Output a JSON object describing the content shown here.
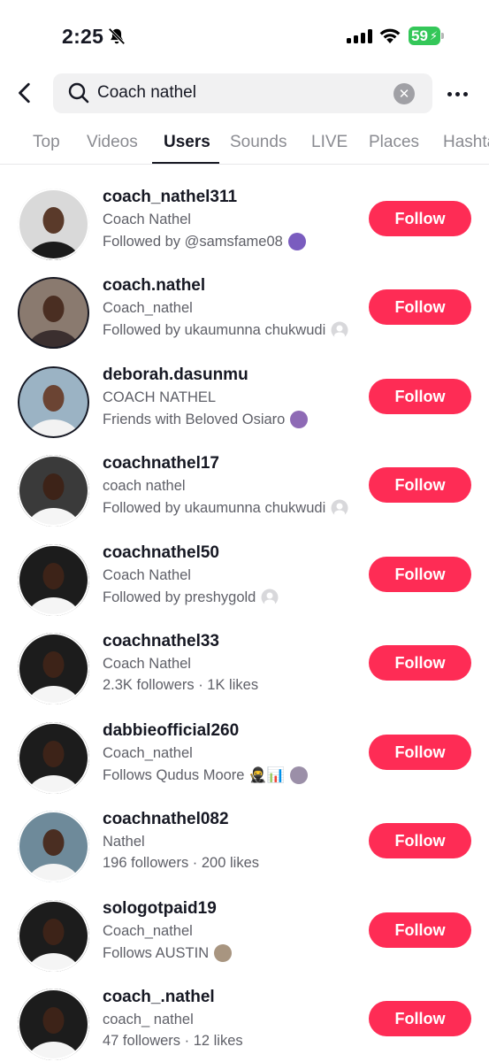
{
  "status": {
    "time": "2:25",
    "battery": "59"
  },
  "search": {
    "query": "Coach nathel",
    "clear_symbol": "✕"
  },
  "tabs": [
    {
      "label": "Top"
    },
    {
      "label": "Videos"
    },
    {
      "label": "Users"
    },
    {
      "label": "Sounds"
    },
    {
      "label": "LIVE"
    },
    {
      "label": "Places"
    },
    {
      "label": "Hashtags"
    }
  ],
  "active_tab": "Users",
  "colors": {
    "accent": "#fe2c55",
    "text": "#161823",
    "secondary": "#5f6068",
    "battery": "#34c759"
  },
  "users": [
    {
      "username": "coach_nathel311",
      "nickname": "Coach Nathel",
      "meta": "Followed by @samsfame08",
      "meta_icon": "mini-avatar-icon",
      "follow_label": "Follow"
    },
    {
      "username": "coach.nathel",
      "nickname": "Coach_nathel",
      "meta": "Followed by ukaumunna chukwudi",
      "meta_icon": "default-avatar-icon",
      "follow_label": "Follow"
    },
    {
      "username": "deborah.dasunmu",
      "nickname": "COACH NATHEL",
      "meta": "Friends with Beloved Osiaro",
      "meta_icon": "mini-avatar-icon",
      "follow_label": "Follow"
    },
    {
      "username": "coachnathel17",
      "nickname": "coach nathel",
      "meta": "Followed by ukaumunna chukwudi",
      "meta_icon": "default-avatar-icon",
      "follow_label": "Follow"
    },
    {
      "username": "coachnathel50",
      "nickname": "Coach Nathel",
      "meta": "Followed by preshygold",
      "meta_icon": "default-avatar-icon",
      "follow_label": "Follow"
    },
    {
      "username": "coachnathel33",
      "nickname": "Coach Nathel",
      "meta": "2.3K followers · 1K likes",
      "meta_icon": "",
      "follow_label": "Follow"
    },
    {
      "username": "dabbieofficial260",
      "nickname": "Coach_nathel",
      "meta": "Follows Qudus Moore 🥷📊",
      "meta_icon": "mini-avatar-icon",
      "follow_label": "Follow"
    },
    {
      "username": "coachnathel082",
      "nickname": "Nathel",
      "meta": "196 followers · 200 likes",
      "meta_icon": "",
      "follow_label": "Follow"
    },
    {
      "username": "sologotpaid19",
      "nickname": "Coach_nathel",
      "meta": "Follows AUSTIN",
      "meta_icon": "mini-avatar-icon",
      "follow_label": "Follow"
    },
    {
      "username": "coach_.nathel",
      "nickname": "coach_ nathel",
      "meta": "47 followers · 12 likes",
      "meta_icon": "",
      "follow_label": "Follow"
    }
  ]
}
